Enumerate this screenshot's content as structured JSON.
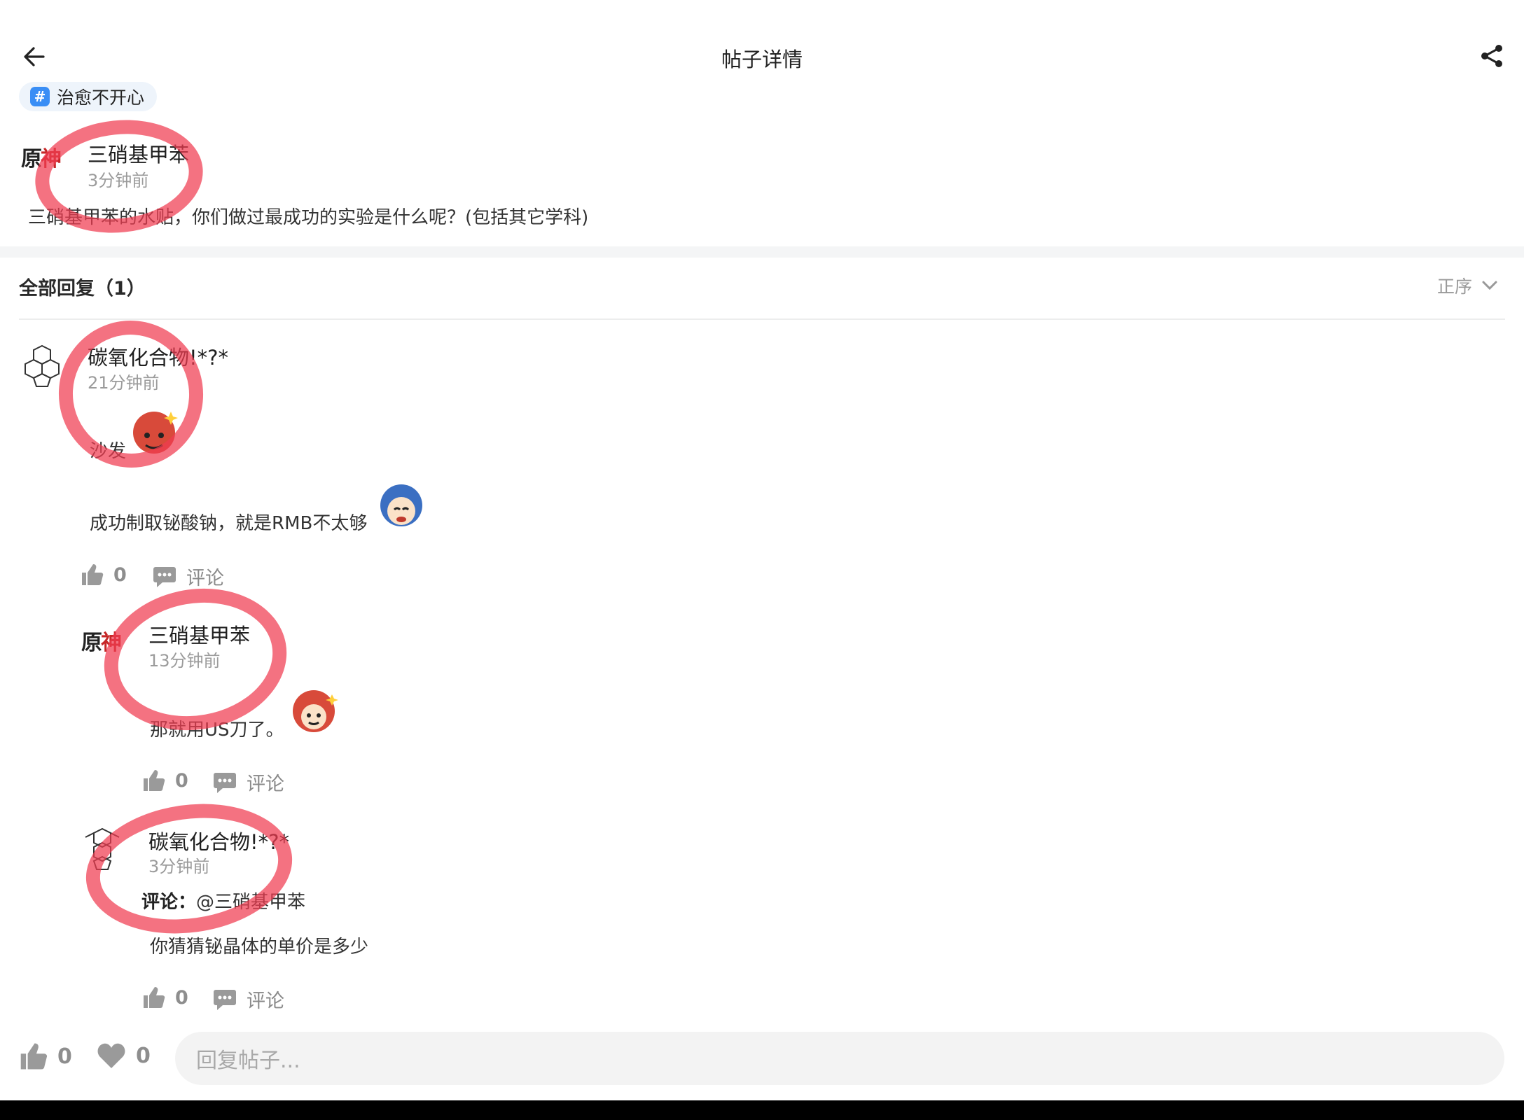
{
  "header": {
    "title": "帖子详情",
    "back_icon": "arrow-left-icon",
    "share_icon": "share-icon"
  },
  "post": {
    "tag": "治愈不开心",
    "tag_icon": "hash-icon",
    "author": "三硝基甲苯",
    "time": "3分钟前",
    "content": "三硝基甲苯的水贴，你们做过最成功的实验是什么呢？(包括其它学科)"
  },
  "replies_header": {
    "title": "全部回复（1）",
    "sort_label": "正序"
  },
  "reply": {
    "author": "碳氧化合物!*?*",
    "time": "21分钟前",
    "line1": "沙发",
    "line2": "成功制取铋酸钠，就是RMB不太够",
    "likes": "0",
    "comment_label": "评论"
  },
  "sub_replies": [
    {
      "author": "三硝基甲苯",
      "time": "13分钟前",
      "content": "那就用US刀了。",
      "likes": "0",
      "comment_label": "评论"
    },
    {
      "author": "碳氧化合物!*?*",
      "time": "3分钟前",
      "comment_prefix": "评论：",
      "mention": "@三硝基甲苯",
      "content": "你猜猜铋晶体的单价是多少",
      "likes": "0",
      "comment_label": "评论"
    }
  ],
  "bottom_bar": {
    "likes": "0",
    "favorites": "0",
    "reply_placeholder": "回复帖子..."
  },
  "colors": {
    "accent_blue": "#3a8ef5",
    "annotation_red": "#f03c50"
  }
}
